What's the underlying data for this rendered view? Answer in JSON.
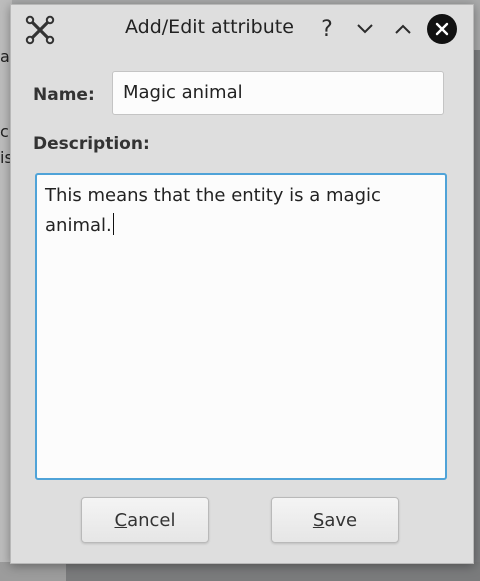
{
  "window": {
    "title": "Add/Edit attribute",
    "help_glyph": "?",
    "app_icon": "cross-icon",
    "controls": [
      "help-icon",
      "minimize-icon",
      "maximize-icon",
      "close-icon"
    ]
  },
  "background": {
    "glyph_1": "c",
    "glyph_2": "is",
    "glyph_3": "a"
  },
  "form": {
    "name_label": "Name:",
    "name_value": "Magic animal",
    "description_label": "Description:",
    "description_value": "This means that the entity is a magic animal."
  },
  "buttons": {
    "cancel_mnemonic": "C",
    "cancel_rest": "ancel",
    "save_mnemonic": "S",
    "save_rest": "ave"
  },
  "colors": {
    "focus_border": "#4fa3d8",
    "window_bg": "#dedede"
  }
}
